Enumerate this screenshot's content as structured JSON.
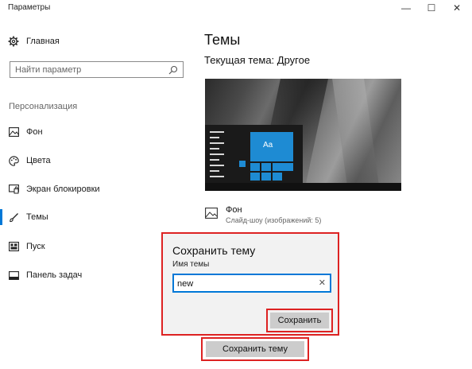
{
  "window": {
    "title": "Параметры",
    "minimize_glyph": "—",
    "maximize_glyph": "☐",
    "close_glyph": "✕"
  },
  "sidebar": {
    "home_label": "Главная",
    "search_placeholder": "Найти параметр",
    "section_label": "Персонализация",
    "items": [
      {
        "label": "Фон",
        "icon": "picture-icon"
      },
      {
        "label": "Цвета",
        "icon": "palette-icon"
      },
      {
        "label": "Экран блокировки",
        "icon": "lock-screen-icon"
      },
      {
        "label": "Темы",
        "icon": "brush-icon",
        "active": true
      },
      {
        "label": "Пуск",
        "icon": "start-icon"
      },
      {
        "label": "Панель задач",
        "icon": "taskbar-icon"
      }
    ]
  },
  "main": {
    "title": "Темы",
    "current_theme": "Текущая тема: Другое",
    "preview": {
      "tile_label": "Aa"
    },
    "background": {
      "title": "Фон",
      "subtitle": "Слайд-шоу (изображений: 5)"
    },
    "save_theme_button": "Сохранить тему"
  },
  "dialog": {
    "title": "Сохранить тему",
    "field_label": "Имя темы",
    "field_value": "new",
    "clear_glyph": "✕",
    "save_button": "Сохранить"
  },
  "colors": {
    "accent": "#0078d7",
    "highlight_border": "#dd2222",
    "tile_blue": "#1e8bd3"
  }
}
